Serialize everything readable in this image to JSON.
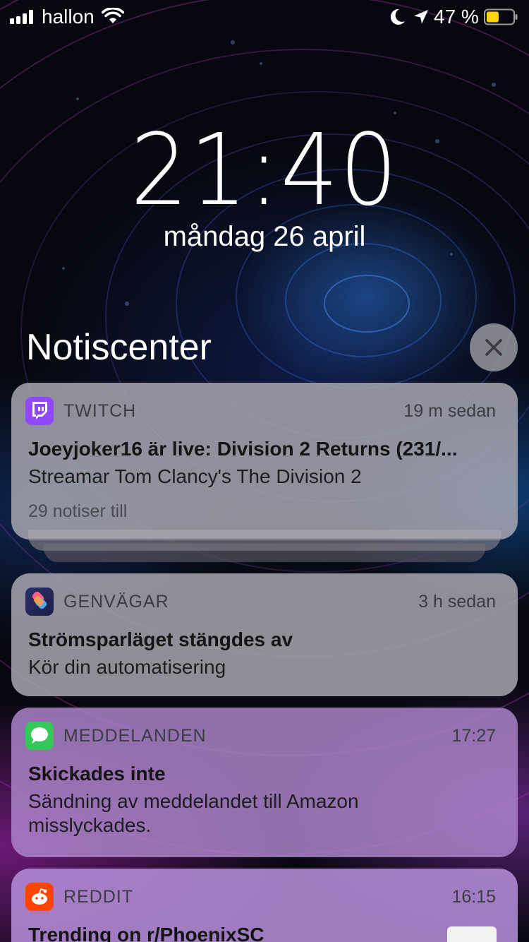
{
  "status_bar": {
    "carrier": "hallon",
    "battery_percent": "47 %",
    "battery_level": 0.47,
    "battery_color": "#ffd60a",
    "icons": [
      "signal-icon",
      "wifi-icon",
      "moon-icon",
      "location-arrow-icon",
      "battery-icon"
    ]
  },
  "lock_screen": {
    "time": "21:40",
    "date": "måndag 26 april"
  },
  "notification_center": {
    "title": "Notiscenter",
    "clear_icon": "close-icon"
  },
  "notifications": [
    {
      "app": "TWITCH",
      "icon": "twitch-icon",
      "icon_color": "#9146ff",
      "time": "19 m sedan",
      "title": "Joeyjoker16 är live: Division 2 Returns (231/...",
      "body": "Streamar Tom Clancy's The Division 2",
      "more": "29 notiser till"
    },
    {
      "app": "GENVÄGAR",
      "icon": "shortcuts-icon",
      "time": "3 h sedan",
      "title": "Strömsparläget stängdes av",
      "body": "Kör din automatisering"
    },
    {
      "app": "MEDDELANDEN",
      "icon": "messages-icon",
      "icon_color": "#34c759",
      "time": "17:27",
      "title": "Skickades inte",
      "body": "Sändning av meddelandet till Amazon misslyckades."
    },
    {
      "app": "REDDIT",
      "icon": "reddit-icon",
      "icon_color": "#ff4500",
      "time": "16:15",
      "title": "Trending on r/PhoenixSC"
    }
  ]
}
